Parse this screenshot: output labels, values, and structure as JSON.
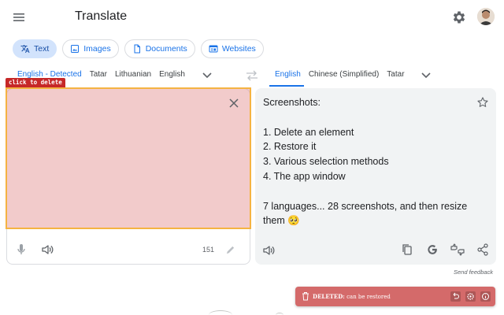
{
  "app": {
    "title": "Translate"
  },
  "mode_tabs": [
    {
      "label": "Text",
      "active": true
    },
    {
      "label": "Images"
    },
    {
      "label": "Documents"
    },
    {
      "label": "Websites"
    }
  ],
  "source": {
    "languages": [
      "English - Detected",
      "Tatar",
      "Lithuanian",
      "English"
    ],
    "active_language": "English - Detected",
    "char_count": "151"
  },
  "target": {
    "languages": [
      "English",
      "Chinese (Simplified)",
      "Tatar"
    ],
    "active_language": "English",
    "text": "Screenshots:\n\n1. Delete an element\n2. Restore it\n3. Various selection methods\n4. The app window\n\n7 languages... 28 screenshots, and then resize them 🥺"
  },
  "overlay": {
    "label": "click to delete"
  },
  "feedback_label": "Send feedback",
  "toast": {
    "status": "DELETED:",
    "message": "can be restored"
  },
  "colors": {
    "accent": "#1a73e8",
    "overlay_fill": "#e28c8c",
    "overlay_border": "#f5b342",
    "toast_bg": "#d46a6a",
    "label_bg": "#c62828"
  }
}
